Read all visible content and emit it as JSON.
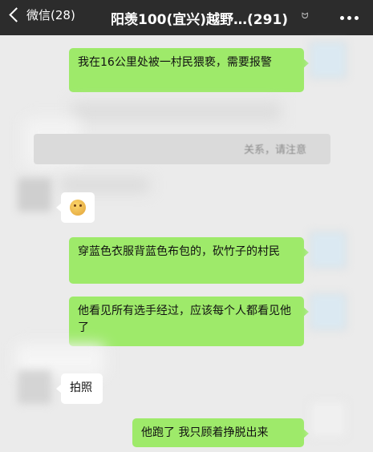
{
  "header": {
    "back_label": "微信(28)",
    "title": "阳羡100(宜兴)越野…(291)",
    "mute_glyph": "፠"
  },
  "messages": [
    {
      "id": "m1",
      "side": "right",
      "text": "我在16公里处被一村民猥亵，需要报警"
    },
    {
      "id": "m2",
      "side": "left",
      "emoji": "sad-face"
    },
    {
      "id": "m3",
      "side": "right",
      "text": "穿蓝色衣服背蓝色布包的，砍竹子的村民"
    },
    {
      "id": "m4",
      "side": "right",
      "text": "他看见所有选手经过，应该每个人都看见他了"
    },
    {
      "id": "m5",
      "side": "left",
      "text": "拍照"
    },
    {
      "id": "m6",
      "side": "right",
      "text": "他跑了 我只顾着挣脱出来"
    }
  ],
  "system_notice": {
    "text": "关系，请注意"
  }
}
